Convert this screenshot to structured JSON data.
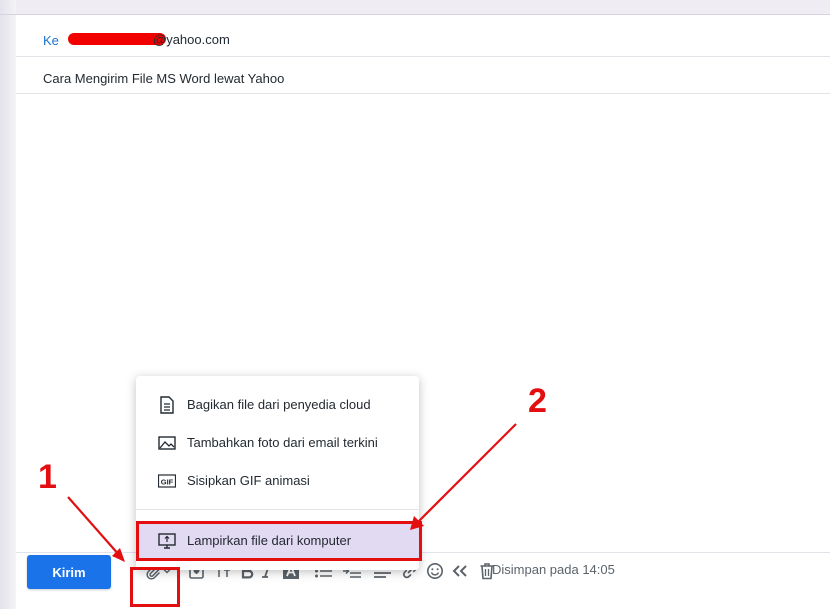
{
  "compose": {
    "to_label": "Ke",
    "to_value": "@yahoo.com",
    "subject": "Cara Mengirim File MS Word lewat Yahoo"
  },
  "toolbar": {
    "send_label": "Kirim",
    "saved_status": "Disimpan pada 14:05",
    "icons": [
      "attachment-icon",
      "chevron-down-icon",
      "sticker-icon",
      "text-size-icon",
      "bold-icon",
      "italic-icon",
      "text-color-icon",
      "bullet-list-icon",
      "indent-icon",
      "align-icon",
      "link-icon",
      "emoji-icon",
      "quote-icon",
      "trash-icon"
    ]
  },
  "attach_menu": {
    "items": [
      {
        "label": "Bagikan file dari penyedia cloud",
        "icon": "document-icon"
      },
      {
        "label": "Tambahkan foto dari email terkini",
        "icon": "image-icon"
      },
      {
        "label": "Sisipkan GIF animasi",
        "icon": "gif-icon"
      },
      {
        "label": "Lampirkan file dari komputer",
        "icon": "computer-icon"
      }
    ],
    "icon_gif_text": "GIF"
  },
  "annotations": {
    "step1": "1",
    "step2": "2",
    "color": "#e30e10"
  },
  "colors": {
    "accent": "#1a73e8",
    "link": "#1d73d1",
    "highlight": "#e2d9f2"
  }
}
